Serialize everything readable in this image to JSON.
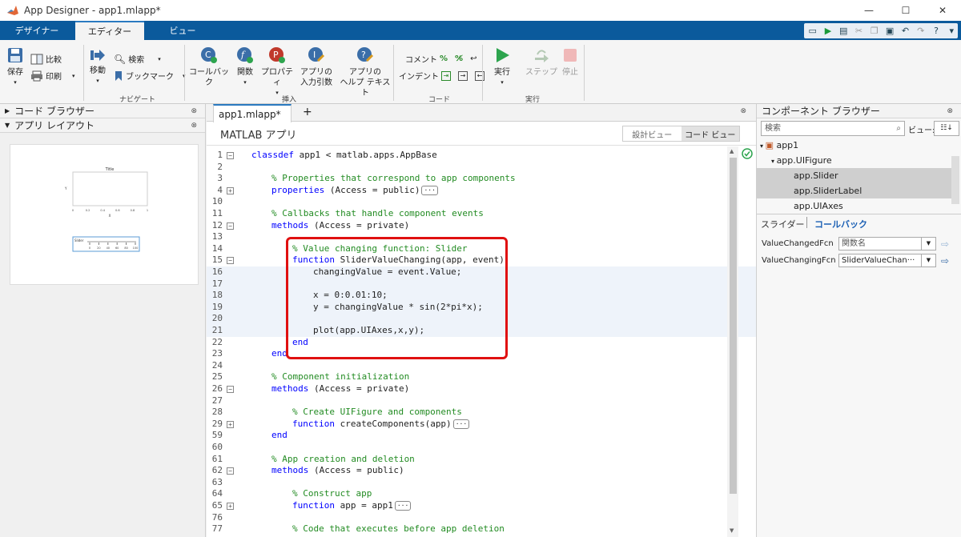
{
  "window": {
    "title": "App Designer - app1.mlapp*",
    "controls": [
      "—",
      "☐",
      "✕"
    ]
  },
  "ribbon_tabs": [
    {
      "label": "デザイナー"
    },
    {
      "label": "エディター"
    },
    {
      "label": "ビュー"
    }
  ],
  "ribbon": {
    "file": {
      "save": "保存",
      "compare": "比較",
      "print": "印刷"
    },
    "navigate": {
      "goto": "移動",
      "find": "検索",
      "bookmark": "ブックマーク",
      "section": "ナビゲート"
    },
    "insert": {
      "callback": "コールバック",
      "function": "関数",
      "property": "プロパティ",
      "appinput_l1": "アプリの",
      "appinput_l2": "入力引数",
      "apphelp_l1": "アプリの",
      "apphelp_l2": "ヘルプ テキスト",
      "section": "挿入"
    },
    "code": {
      "comment": "コメント",
      "indent": "インデント",
      "section": "コード"
    },
    "run": {
      "run": "実行",
      "step": "ステップ",
      "stop": "停止",
      "section": "実行"
    }
  },
  "left_pane": {
    "code_browser": "コード ブラウザー",
    "app_layout": "アプリ レイアウト"
  },
  "preview": {
    "title": "Title",
    "xlabel": "X",
    "ylabel": "Y",
    "slider_label": "Slider",
    "x_ticks": [
      "0",
      "0.2",
      "0.4",
      "0.6",
      "0.8",
      "1"
    ],
    "slider_ticks": [
      "0",
      "20",
      "40",
      "60",
      "80",
      "100"
    ]
  },
  "editor": {
    "tab": "app1.mlapp*",
    "add_tab": "+",
    "app_title": "MATLAB アプリ",
    "design_view": "設計ビュー",
    "code_view": "コード ビュー",
    "lines": [
      {
        "n": "1",
        "fold": "−",
        "parts": [
          {
            "t": "classdef",
            "c": "kw"
          },
          {
            "t": " app1 < matlab.apps.AppBase"
          }
        ],
        "indent": 0
      },
      {
        "n": "2",
        "parts": [],
        "indent": 0
      },
      {
        "n": "3",
        "parts": [
          {
            "t": "% Properties that correspond to app components",
            "c": "cm"
          }
        ],
        "indent": 1
      },
      {
        "n": "4",
        "fold": "+",
        "parts": [
          {
            "t": "properties",
            "c": "kw"
          },
          {
            "t": " (Access = public)"
          }
        ],
        "ellipsis": true,
        "indent": 1
      },
      {
        "n": "10",
        "parts": [],
        "indent": 0
      },
      {
        "n": "11",
        "parts": [
          {
            "t": "% Callbacks that handle component events",
            "c": "cm"
          }
        ],
        "indent": 1
      },
      {
        "n": "12",
        "fold": "−",
        "parts": [
          {
            "t": "methods",
            "c": "kw"
          },
          {
            "t": " (Access = private)"
          }
        ],
        "indent": 1
      },
      {
        "n": "13",
        "parts": [],
        "indent": 0
      },
      {
        "n": "14",
        "parts": [
          {
            "t": "% Value changing function: Slider",
            "c": "cm"
          }
        ],
        "indent": 2
      },
      {
        "n": "15",
        "fold": "−",
        "parts": [
          {
            "t": "function",
            "c": "kw"
          },
          {
            "t": " SliderValueChanging(app, event)"
          }
        ],
        "indent": 2
      },
      {
        "n": "16",
        "parts": [
          {
            "t": "changingValue = event.Value;"
          }
        ],
        "indent": 3,
        "hl": true
      },
      {
        "n": "17",
        "parts": [],
        "indent": 0,
        "hl": true
      },
      {
        "n": "18",
        "parts": [
          {
            "t": "x = 0:0.01:10;"
          }
        ],
        "indent": 3,
        "hl": true
      },
      {
        "n": "19",
        "parts": [
          {
            "t": "y = changingValue * sin(2*pi*x);"
          }
        ],
        "indent": 3,
        "hl": true
      },
      {
        "n": "20",
        "parts": [],
        "indent": 0,
        "hl": true
      },
      {
        "n": "21",
        "parts": [
          {
            "t": "plot(app.UIAxes,x,y);"
          }
        ],
        "indent": 3,
        "hl": true
      },
      {
        "n": "22",
        "parts": [
          {
            "t": "end",
            "c": "kw"
          }
        ],
        "indent": 2
      },
      {
        "n": "23",
        "parts": [
          {
            "t": "end",
            "c": "kw"
          }
        ],
        "indent": 1
      },
      {
        "n": "24",
        "parts": [],
        "indent": 0
      },
      {
        "n": "25",
        "parts": [
          {
            "t": "% Component initialization",
            "c": "cm"
          }
        ],
        "indent": 1
      },
      {
        "n": "26",
        "fold": "−",
        "parts": [
          {
            "t": "methods",
            "c": "kw"
          },
          {
            "t": " (Access = private)"
          }
        ],
        "indent": 1
      },
      {
        "n": "27",
        "parts": [],
        "indent": 0
      },
      {
        "n": "28",
        "parts": [
          {
            "t": "% Create UIFigure and components",
            "c": "cm"
          }
        ],
        "indent": 2
      },
      {
        "n": "29",
        "fold": "+",
        "parts": [
          {
            "t": "function",
            "c": "kw"
          },
          {
            "t": " createComponents(app)"
          }
        ],
        "ellipsis": true,
        "indent": 2
      },
      {
        "n": "59",
        "parts": [
          {
            "t": "end",
            "c": "kw"
          }
        ],
        "indent": 1
      },
      {
        "n": "60",
        "parts": [],
        "indent": 0
      },
      {
        "n": "61",
        "parts": [
          {
            "t": "% App creation and deletion",
            "c": "cm"
          }
        ],
        "indent": 1
      },
      {
        "n": "62",
        "fold": "−",
        "parts": [
          {
            "t": "methods",
            "c": "kw"
          },
          {
            "t": " (Access = public)"
          }
        ],
        "indent": 1
      },
      {
        "n": "63",
        "parts": [],
        "indent": 0
      },
      {
        "n": "64",
        "parts": [
          {
            "t": "% Construct app",
            "c": "cm"
          }
        ],
        "indent": 2
      },
      {
        "n": "65",
        "fold": "+",
        "parts": [
          {
            "t": "function",
            "c": "kw"
          },
          {
            "t": " app = app1"
          }
        ],
        "ellipsis": true,
        "indent": 2
      },
      {
        "n": "76",
        "parts": [],
        "indent": 0
      },
      {
        "n": "77",
        "parts": [
          {
            "t": "% Code that executes before app deletion",
            "c": "cm"
          }
        ],
        "indent": 2
      }
    ]
  },
  "right_pane": {
    "title": "コンポーネント ブラウザー",
    "search_placeholder": "検索",
    "view_label": "ビュー:",
    "tree": [
      {
        "label": "app1",
        "level": 0,
        "selected": false
      },
      {
        "label": "app.UIFigure",
        "level": 1,
        "selected": false
      },
      {
        "label": "app.Slider",
        "level": 2,
        "selected": true
      },
      {
        "label": "app.SliderLabel",
        "level": 2,
        "selected": true
      },
      {
        "label": "app.UIAxes",
        "level": 2,
        "selected": false
      }
    ],
    "tab_slider": "スライダー",
    "tab_callback": "コールバック",
    "props": [
      {
        "name": "ValueChangedFcn",
        "value": "関数名"
      },
      {
        "name": "ValueChangingFcn",
        "value": "SliderValueChan···"
      }
    ]
  }
}
